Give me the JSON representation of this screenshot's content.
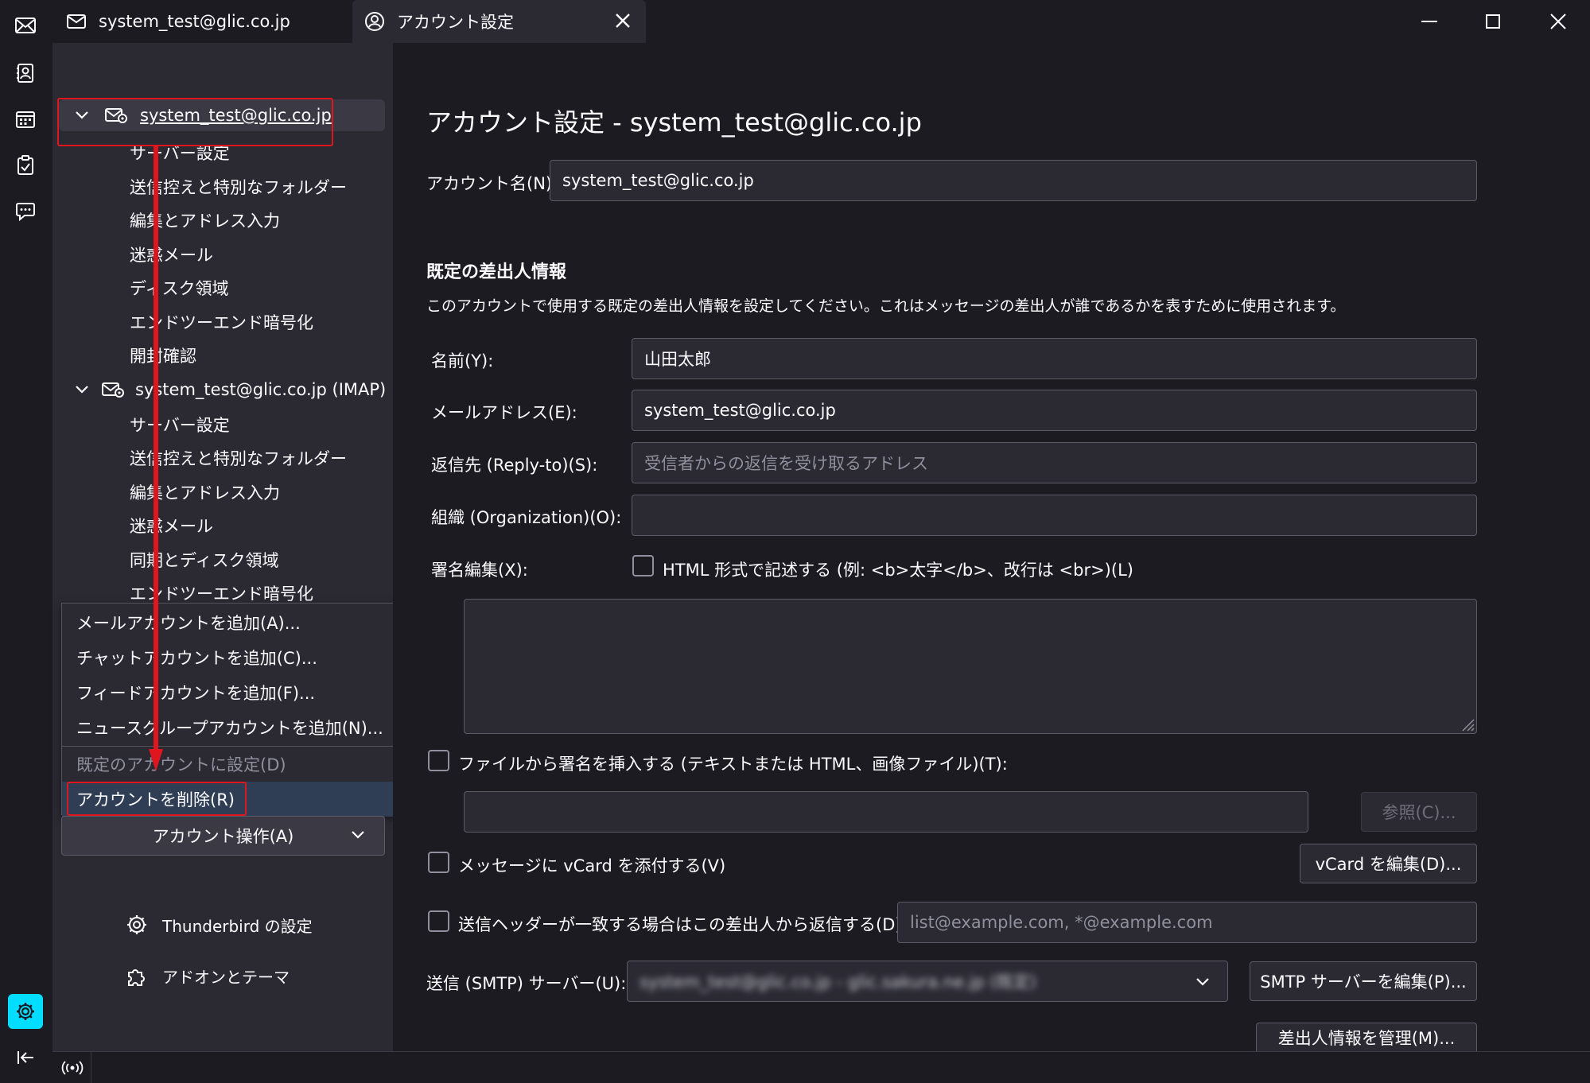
{
  "tabs": [
    {
      "label": "system_test@glic.co.jp",
      "icon": "mail-icon"
    },
    {
      "label": "アカウント設定",
      "icon": "account-settings-icon"
    }
  ],
  "sidebar": {
    "accounts": [
      {
        "name": "system_test@glic.co.jp",
        "items": [
          "サーバー設定",
          "送信控えと特別なフォルダー",
          "編集とアドレス入力",
          "迷惑メール",
          "ディスク領域",
          "エンドツーエンド暗号化",
          "開封確認"
        ]
      },
      {
        "name": "system_test@glic.co.jp (IMAP)",
        "items": [
          "サーバー設定",
          "送信控えと特別なフォルダー",
          "編集とアドレス入力",
          "迷惑メール",
          "同期とディスク領域",
          "エンドツーエンド暗号化"
        ]
      }
    ],
    "menu": {
      "add_mail": "メールアカウントを追加(A)...",
      "add_chat": "チャットアカウントを追加(C)...",
      "add_feed": "フィードアカウントを追加(F)...",
      "add_news": "ニュースグループアカウントを追加(N)...",
      "set_default": "既定のアカウントに設定(D)",
      "delete_account": "アカウントを削除(R)"
    },
    "account_actions": "アカウント操作(A)",
    "thunderbird_settings": "Thunderbird の設定",
    "addons": "アドオンとテーマ"
  },
  "main": {
    "title": "アカウント設定 - system_test@glic.co.jp",
    "account_name_label": "アカウント名(N):",
    "account_name_value": "system_test@glic.co.jp",
    "identity_heading": "既定の差出人情報",
    "identity_desc": "このアカウントで使用する既定の差出人情報を設定してください。これはメッセージの差出人が誰であるかを表すために使用されます。",
    "name_label": "名前(Y):",
    "name_value": "山田太郎",
    "email_label": "メールアドレス(E):",
    "email_value": "system_test@glic.co.jp",
    "replyto_label": "返信先 (Reply-to)(S):",
    "replyto_placeholder": "受信者からの返信を受け取るアドレス",
    "org_label": "組織 (Organization)(O):",
    "org_value": "",
    "signature_label": "署名編集(X):",
    "html_signature_label": "HTML 形式で記述する (例: <b>太字</b>、改行は <br>)(L)",
    "signature_text": "",
    "attach_sig_label": "ファイルから署名を挿入する (テキストまたは HTML、画像ファイル)(T):",
    "sig_file_value": "",
    "browse_button": "参照(C)...",
    "vcard_label": "メッセージに vCard を添付する(V)",
    "vcard_button": "vCard を編集(D)...",
    "reply_header_label": "送信ヘッダーが一致する場合はこの差出人から返信する(D):",
    "reply_header_placeholder": "list@example.com, *@example.com",
    "smtp_label": "送信 (SMTP) サーバー(U):",
    "smtp_value": "system_test@glic.co.jp - glic.sakura.ne.jp (既定)",
    "smtp_button": "SMTP サーバーを編集(P)...",
    "manage_identities_button": "差出人情報を管理(M)..."
  },
  "colors": {
    "accent": "#00ddff",
    "highlight": "#e0161e",
    "menu_selected": "#2f3e55"
  }
}
